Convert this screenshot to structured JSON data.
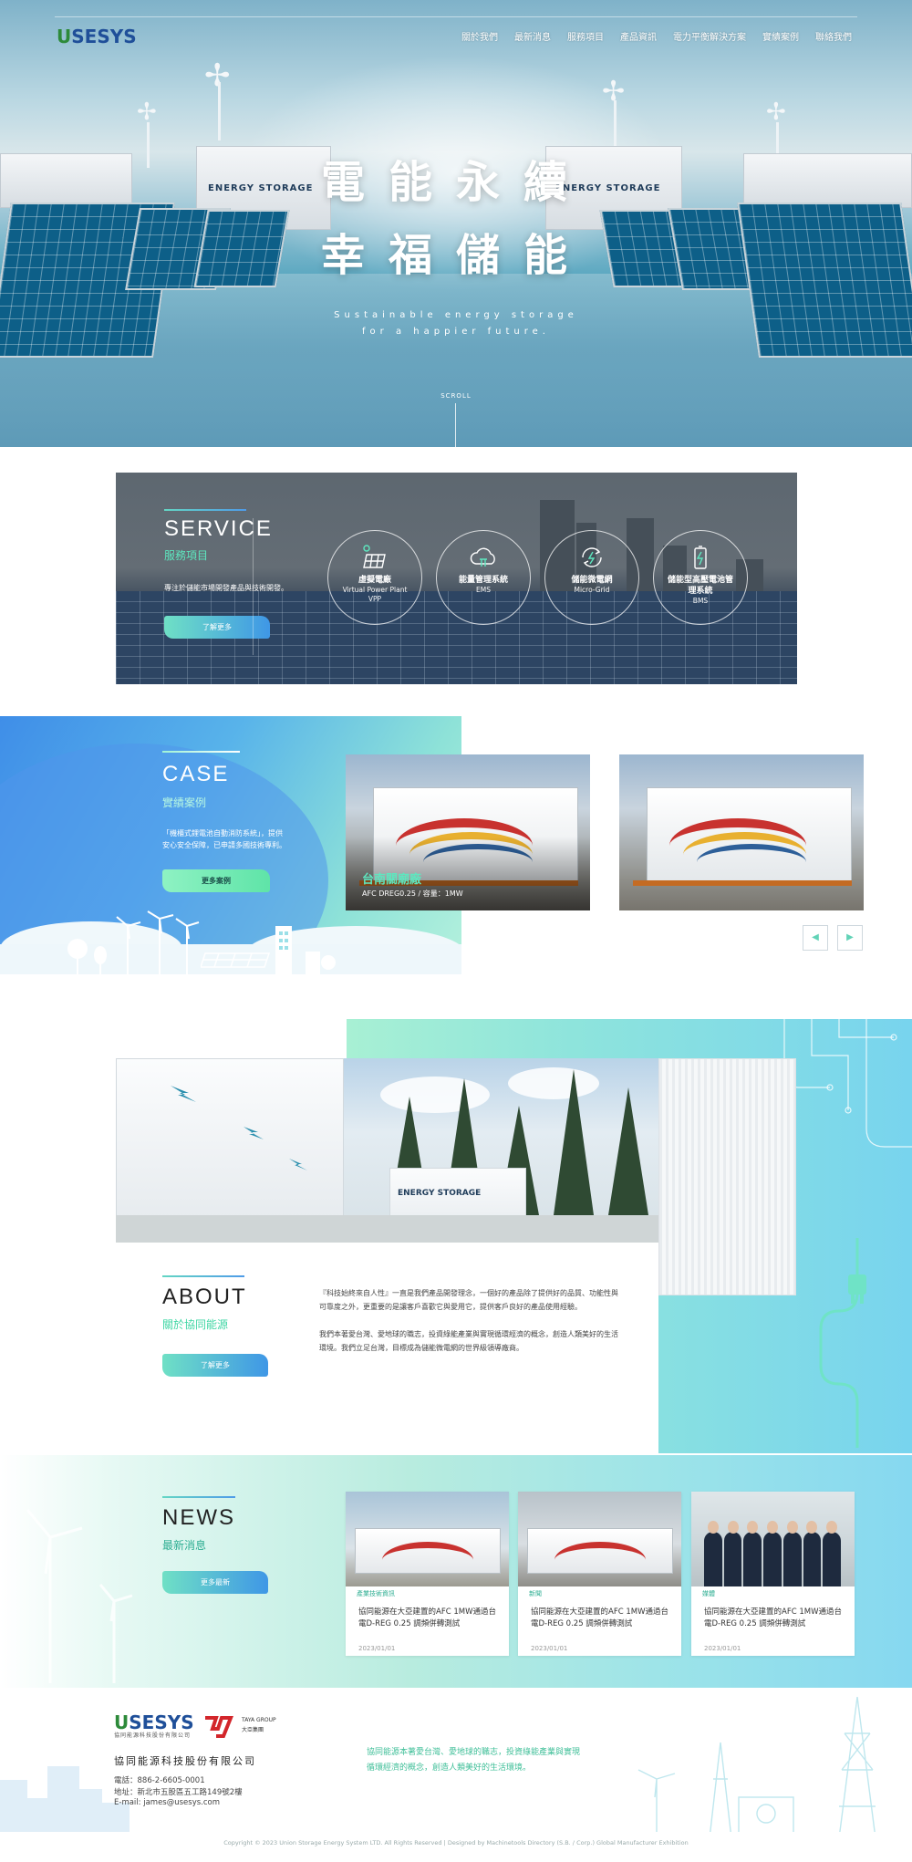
{
  "nav": {
    "logo": "USESYS",
    "items": [
      "關於我們",
      "最新消息",
      "服務項目",
      "產品資訊",
      "電力平衡解決方案",
      "實績案例",
      "聯絡我們"
    ]
  },
  "hero": {
    "title_line1": "電能永續",
    "title_line2": "幸福儲能",
    "sub_line1": "Sustainable energy storage",
    "sub_line2": "for a happier future.",
    "scroll": "SCROLL",
    "container_label": "ENERGY STORAGE"
  },
  "service": {
    "title_en": "SERVICE",
    "title_zh": "服務項目",
    "desc": "專注於儲能市場開發產品與技術開發。",
    "button": "了解更多",
    "items": [
      {
        "title": "虛擬電廠",
        "sub1": "Virtual Power Plant",
        "sub2": "VPP",
        "icon": "solar-panel-icon"
      },
      {
        "title": "能量管理系統",
        "sub1": "EMS",
        "sub2": "",
        "icon": "cloud-power-icon"
      },
      {
        "title": "儲能微電網",
        "sub1": "Micro-Grid",
        "sub2": "",
        "icon": "recycle-energy-icon"
      },
      {
        "title": "儲能型高壓電池管",
        "sub1": "理系統",
        "sub2": "BMS",
        "icon": "battery-icon"
      }
    ]
  },
  "case": {
    "title_en": "CASE",
    "title_zh": "實績案例",
    "desc_line1": "「機櫃式鋰電池自動消防系統」，提供",
    "desc_line2": "安心安全保障，已申請多國技術專利。",
    "button": "更多案例",
    "cards": [
      {
        "name": "台南關廟廠",
        "spec": "AFC DREG0.25 / 容量：1MW"
      },
      {
        "name": "",
        "spec": ""
      }
    ],
    "prev": "◀",
    "next": "▶"
  },
  "about": {
    "title_en": "ABOUT",
    "title_zh": "關於協同能源",
    "button": "了解更多",
    "para1_line1": "『科技始終來自人性』一直是我們產品開發理念，一個好的產品除了提供好的品質、功能性與",
    "para1_line2": "可靠度之外，更重要的是讓客戶喜歡它與愛用它，提供客戶良好的產品使用經驗。",
    "para2_line1": "我們本著愛台灣、愛地球的職志，投資綠能產業與實現循環經濟的概念，創造人類美好的生活",
    "para2_line2": "環境。我們立足台灣，目標成為儲能微電網的世界級領導廠商。",
    "photo_label": "ENERGY STORAGE"
  },
  "news": {
    "title_en": "NEWS",
    "title_zh": "最新消息",
    "button": "更多最新",
    "cards": [
      {
        "tag": "產業技術資訊",
        "title": "協同能源在大亞建置的AFC 1MW通過台電D-REG 0.25 調頻併轉測試",
        "date": "2023/01/01"
      },
      {
        "tag": "新聞",
        "title": "協同能源在大亞建置的AFC 1MW通過台電D-REG 0.25 調頻併轉測試",
        "date": "2023/01/01"
      },
      {
        "tag": "媒體",
        "title": "協同能源在大亞建置的AFC 1MW通過台電D-REG 0.25 調頻併轉測試",
        "date": "2023/01/01"
      }
    ]
  },
  "footer": {
    "logo": "USESYS",
    "logo_sub": "協同能源科技股份有限公司",
    "partner": "TAYA GROUP",
    "partner_zh": "大亞集團",
    "company": "協同能源科技股份有限公司",
    "phone": "電話：886-2-6605-0001",
    "address": "地址：新北市五股區五工路149號2樓",
    "email": "E-mail: james@usesys.com",
    "slogan": "協同能源本著愛台灣、愛地球的職志，投資綠能產業與實現循環經濟的概念，創造人類美好的生活環境。",
    "copyright": "Copyright © 2023 Union Storage Energy System LTD. All Rights Reserved | Designed by Machinetools Directory (S.B. / Corp.) Global Manufacturer Exhibition"
  },
  "colors": {
    "accent_green": "#5ee7bf",
    "accent_blue": "#3f97e6",
    "brand_green": "#2d8a3a",
    "brand_blue": "#1f4f99"
  }
}
